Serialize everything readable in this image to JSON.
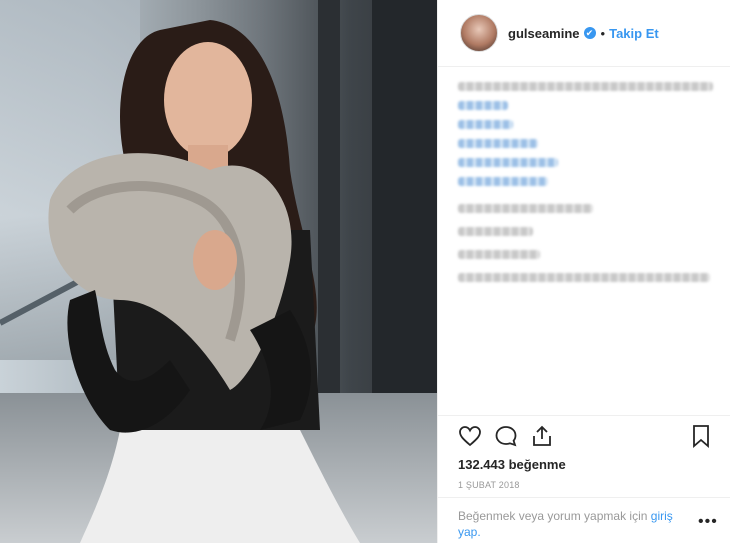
{
  "post": {
    "username": "gulseamine",
    "verified_icon": "✔",
    "separator": "•",
    "follow_label": "Takip Et",
    "likes": "132.443 beğenme",
    "date": "1 ŞUBAT 2018",
    "login_prompt": "Beğenmek veya yorum yapmak için",
    "login_link_1": "giriş",
    "login_link_2": "yap.",
    "more_icon": "•••"
  },
  "icons": [
    "heart-icon",
    "comment-icon",
    "share-icon",
    "bookmark-icon",
    "verified-badge-icon"
  ],
  "colors": {
    "accent": "#3897f0",
    "text": "#262626",
    "muted": "#999999",
    "border": "#efefef"
  }
}
